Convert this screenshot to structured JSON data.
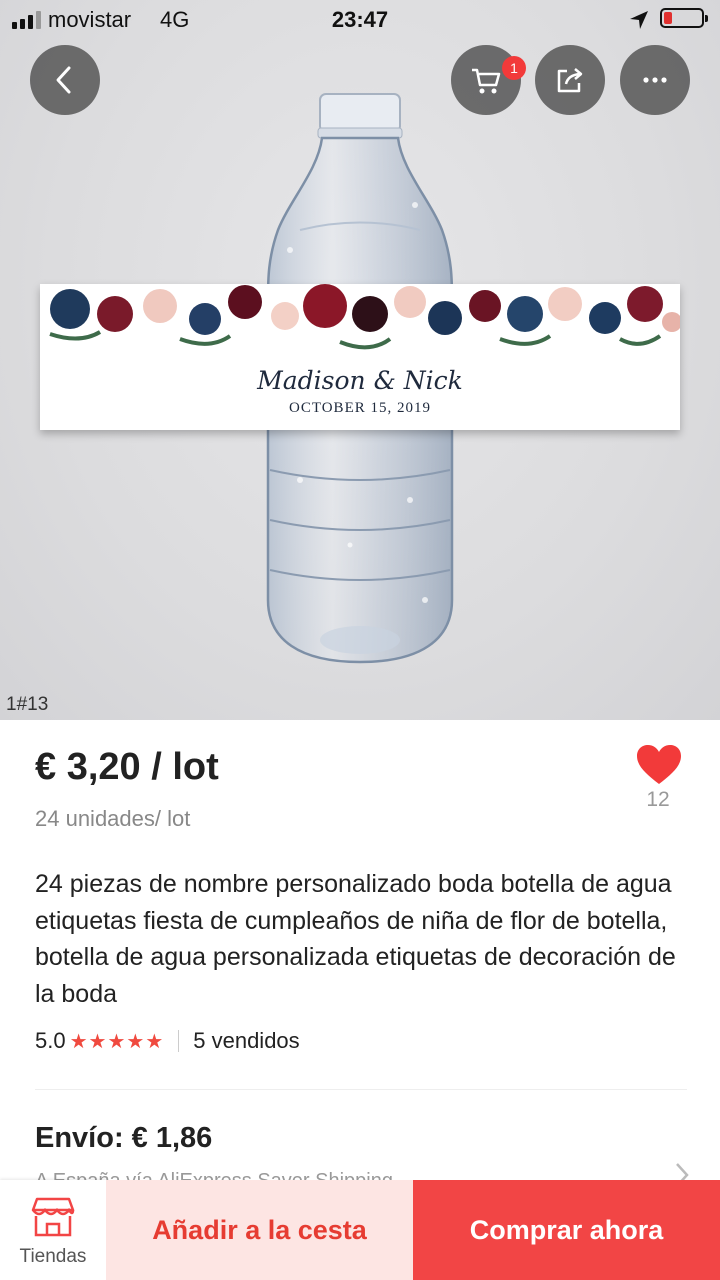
{
  "status_bar": {
    "carrier": "movistar",
    "network": "4G",
    "time": "23:47"
  },
  "header": {
    "cart_badge": "1",
    "back_icon": "back-chevron-icon",
    "cart_icon": "cart-icon",
    "share_icon": "share-icon",
    "more_icon": "more-dots-icon"
  },
  "gallery": {
    "counter": "1#13",
    "label_names": "Madison & Nick",
    "label_date": "OCTOBER 15, 2019"
  },
  "product": {
    "price": "€ 3,20 / lot",
    "unit": "24 unidades/ lot",
    "wishlist_count": "12",
    "title": "24 piezas de nombre personalizado boda botella de agua etiquetas fiesta de cumpleaños de niña de flor de botella, botella de agua personalizada etiquetas de decoración de la boda",
    "rating": "5.0",
    "stars": "★★★★★",
    "sold": "5 vendidos"
  },
  "shipping": {
    "label": "Envío: € 1,86",
    "sub": "A España vía AliExpress Saver Shipping"
  },
  "bottom_bar": {
    "store_label": "Tiendas",
    "add_to_cart": "Añadir a la cesta",
    "buy_now": "Comprar ahora"
  },
  "colors": {
    "accent": "#f24545",
    "accent_light": "#fde5e3",
    "heart": "#f23a3a"
  }
}
